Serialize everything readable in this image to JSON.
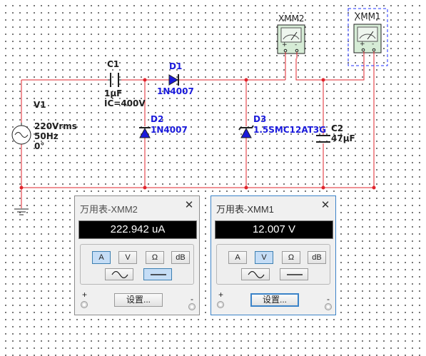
{
  "schematic": {
    "v1": {
      "ref": "V1",
      "voltage": "220Vrms",
      "freq": "50Hz",
      "phase": "0°"
    },
    "c1": {
      "ref": "C1",
      "value": "1µF",
      "ic": "IC=400V"
    },
    "d1": {
      "ref": "D1",
      "part": "1N4007"
    },
    "d2": {
      "ref": "D2",
      "part": "1N4007"
    },
    "d3": {
      "ref": "D3",
      "part": "1.5SMC12AT3G"
    },
    "c2": {
      "ref": "C2",
      "value": "47µF"
    },
    "xmm2": {
      "ref": "XMM2",
      "plus": "+",
      "minus": "-"
    },
    "xmm1": {
      "ref": "XMM1",
      "plus": "+",
      "minus": "-"
    }
  },
  "multimeters": [
    {
      "title": "万用表-XMM2",
      "close": "✕",
      "reading": "222.942 uA",
      "mode_buttons": [
        "A",
        "V",
        "Ω",
        "dB"
      ],
      "selected_mode": "A",
      "selected_wave": "dc",
      "settings_label": "设置...",
      "plus_label": "+",
      "minus_label": "-",
      "active": false
    },
    {
      "title": "万用表-XMM1",
      "close": "✕",
      "reading": "12.007 V",
      "mode_buttons": [
        "A",
        "V",
        "Ω",
        "dB"
      ],
      "selected_mode": "V",
      "selected_wave": "dc",
      "settings_label": "设置...",
      "plus_label": "+",
      "minus_label": "-",
      "active": true
    }
  ],
  "colors": {
    "wire": "#e0242c",
    "component": "#202020",
    "component_label": "#1a1adb",
    "selection": "#2233ff"
  }
}
